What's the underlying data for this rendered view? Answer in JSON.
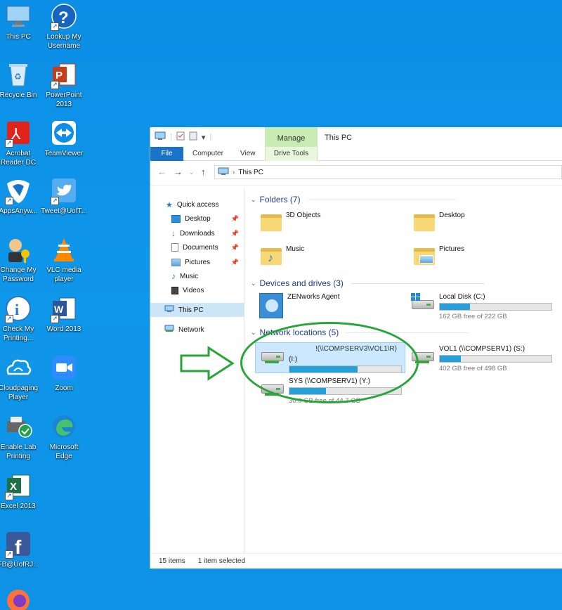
{
  "desktop_icons": [
    {
      "label": "This PC",
      "icon": "this-pc-icon"
    },
    {
      "label": "Lookup My\nUsername",
      "icon": "question-icon"
    },
    {
      "label": "Recycle Bin",
      "icon": "recycle-bin-icon"
    },
    {
      "label": "PowerPoint\n2013",
      "icon": "powerpoint-icon"
    },
    {
      "label": "Acrobat\nReader DC",
      "icon": "acrobat-icon"
    },
    {
      "label": "TeamViewer",
      "icon": "teamviewer-icon"
    },
    {
      "label": "AppsAnyw...",
      "icon": "appsanywhere-icon"
    },
    {
      "label": "Tweet@UofT...",
      "icon": "twitter-icon"
    },
    {
      "label": "Change My\nPassword",
      "icon": "key-person-icon"
    },
    {
      "label": "VLC media\nplayer",
      "icon": "vlc-icon"
    },
    {
      "label": "Check My\nPrinting...",
      "icon": "info-icon"
    },
    {
      "label": "Word 2013",
      "icon": "word-icon"
    },
    {
      "label": "Cloudpaging\nPlayer",
      "icon": "cloud-icon"
    },
    {
      "label": "Zoom",
      "icon": "zoom-icon"
    },
    {
      "label": "Enable Lab\nPrinting",
      "icon": "printer-check-icon"
    },
    {
      "label": "Microsoft\nEdge",
      "icon": "edge-icon"
    },
    {
      "label": "Excel 2013",
      "icon": "excel-icon"
    },
    {
      "label": "FB@UofRJ...",
      "icon": "facebook-icon"
    },
    {
      "label": "",
      "icon": "firefox-icon"
    }
  ],
  "explorer": {
    "title": "This PC",
    "context_tab": "Manage",
    "ribbon_tabs": [
      "File",
      "Computer",
      "View",
      "Drive Tools"
    ],
    "address": "This PC",
    "nav": {
      "quick_access": "Quick access",
      "items": [
        "Desktop",
        "Downloads",
        "Documents",
        "Pictures",
        "Music",
        "Videos"
      ],
      "this_pc": "This PC",
      "network": "Network"
    },
    "groups": {
      "folders": "Folders (7)",
      "devices": "Devices and drives (3)",
      "network": "Network locations (5)"
    },
    "folders": [
      "3D Objects",
      "Desktop",
      "Music",
      "Pictures"
    ],
    "devices": [
      {
        "name": "ZENworks Agent"
      },
      {
        "name": "Local Disk (C:)",
        "free": "162 GB free of 222 GB",
        "used_fraction": 0.27
      }
    ],
    "network_locations": [
      {
        "name_line1": "!(\\\\COMPSERV3\\VOL1\\R)",
        "name_line2": "(I:)",
        "used_fraction": 0.61
      },
      {
        "name": "VOL1 (\\\\COMPSERV1) (S:)",
        "free": "402 GB free of 498 GB",
        "used_fraction": 0.19
      },
      {
        "name": "SYS (\\\\COMPSERV1) (Y:)",
        "free": "30.0 GB free of 44.7 GB",
        "used_fraction": 0.33
      }
    ],
    "status": {
      "items": "15 items",
      "selected": "1 item selected"
    }
  },
  "colors": {
    "desktop": "#0f97ea",
    "selection": "#cce8ff",
    "annotation": "#27a538",
    "bar_fill": "#26a0da"
  }
}
